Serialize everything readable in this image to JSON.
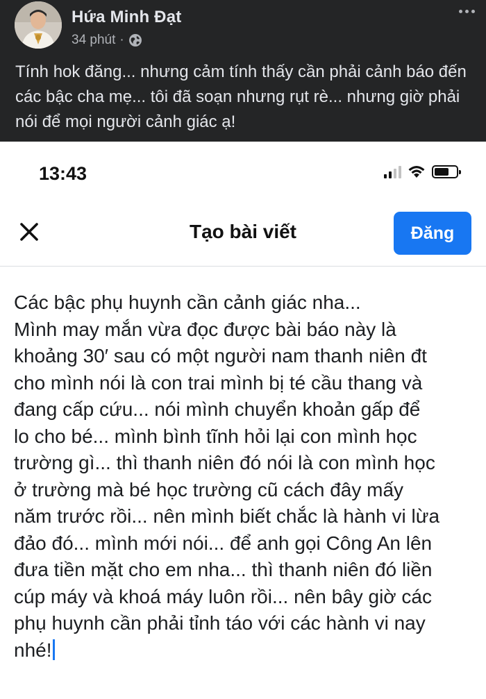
{
  "post": {
    "author": "Hứa Minh Đạt",
    "time": "34 phút",
    "separator": "·",
    "privacy_icon": "globe-icon",
    "menu_icon": "more-horizontal-icon",
    "text": "Tính hok đăng... nhưng cảm tính thấy cần phải cảnh báo đến các bậc cha mẹ... tôi đã soạn nhưng rụt rè... nhưng giờ phải nói để mọi người cảnh giác ạ!"
  },
  "phone": {
    "status_bar": {
      "time": "13:43",
      "icons": [
        "signal-icon",
        "wifi-icon",
        "battery-icon"
      ]
    },
    "compose": {
      "close_icon": "close-icon",
      "title": "Tạo bài viết",
      "post_button": "Đăng",
      "body_lines": [
        "Các bậc phụ huynh cần cảnh giác nha...",
        "Mình may mắn vừa đọc được bài báo này là",
        "khoảng 30′ sau có một người nam thanh niên đt",
        "cho mình nói là con trai mình bị té cầu thang và",
        "đang cấp cứu... nói mình chuyển khoản gấp để",
        "lo cho bé... mình bình tĩnh hỏi lại con mình học",
        "trường gì... thì thanh niên đó nói là con mình học",
        "ở trường mà bé học  trường cũ cách đây mấy",
        "năm trước rồi... nên mình biết chắc là hành vi lừa",
        "đảo đó... mình mới nói... để anh gọi Công An lên",
        "đưa tiền mặt cho em nha... thì thanh niên đó liền",
        "cúp máy và khoá máy luôn rồi... nên bây giờ các",
        "phụ huynh cần phải tỉnh táo với các hành vi nay",
        "nhé!"
      ]
    }
  },
  "colors": {
    "post_background": "#242526",
    "post_text": "#e4e6eb",
    "meta_text": "#b0b3b8",
    "accent": "#1877f2"
  }
}
